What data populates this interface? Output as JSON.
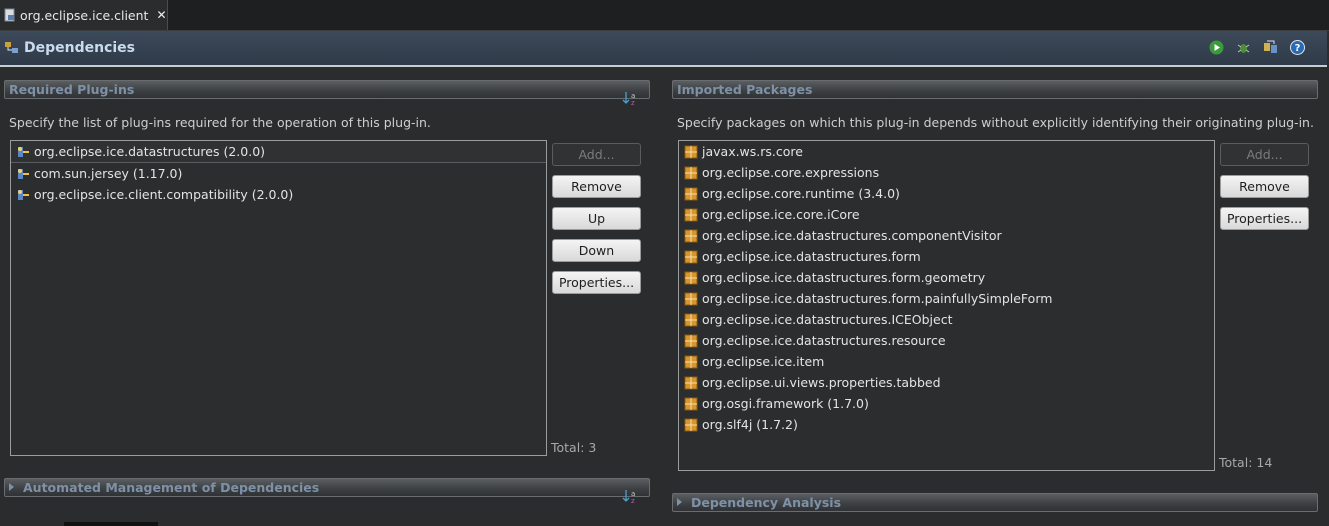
{
  "editor_tab": {
    "label": "org.eclipse.ice.client",
    "close": "✕",
    "icon": "plugin-manifest-icon"
  },
  "form": {
    "title": "Dependencies",
    "title_icon": "dependencies-icon",
    "toolbar_icons": [
      "run-icon",
      "debug-icon",
      "export-icon",
      "help-icon"
    ]
  },
  "required_plugins": {
    "title": "Required Plug-ins",
    "description": "Specify the list of plug-ins required for the operation of this plug-in.",
    "items": [
      {
        "label": "org.eclipse.ice.datastructures (2.0.0)",
        "icon": "plugin-icon"
      },
      {
        "label": "com.sun.jersey (1.17.0)",
        "icon": "plugin-icon"
      },
      {
        "label": "org.eclipse.ice.client.compatibility (2.0.0)",
        "icon": "plugin-icon"
      }
    ],
    "buttons": {
      "add": "Add...",
      "remove": "Remove",
      "up": "Up",
      "down": "Down",
      "properties": "Properties..."
    },
    "total": "Total: 3"
  },
  "imported_packages": {
    "title": "Imported Packages",
    "description": "Specify packages on which this plug-in depends without explicitly identifying their originating plug-in.",
    "items": [
      {
        "label": "javax.ws.rs.core",
        "icon": "package-icon"
      },
      {
        "label": "org.eclipse.core.expressions",
        "icon": "package-icon"
      },
      {
        "label": "org.eclipse.core.runtime (3.4.0)",
        "icon": "package-icon"
      },
      {
        "label": "org.eclipse.ice.core.iCore",
        "icon": "package-icon"
      },
      {
        "label": "org.eclipse.ice.datastructures.componentVisitor",
        "icon": "package-icon"
      },
      {
        "label": "org.eclipse.ice.datastructures.form",
        "icon": "package-icon"
      },
      {
        "label": "org.eclipse.ice.datastructures.form.geometry",
        "icon": "package-icon"
      },
      {
        "label": "org.eclipse.ice.datastructures.form.painfullySimpleForm",
        "icon": "package-icon"
      },
      {
        "label": "org.eclipse.ice.datastructures.ICEObject",
        "icon": "package-icon"
      },
      {
        "label": "org.eclipse.ice.datastructures.resource",
        "icon": "package-icon"
      },
      {
        "label": "org.eclipse.ice.item",
        "icon": "package-icon"
      },
      {
        "label": "org.eclipse.ui.views.properties.tabbed",
        "icon": "package-icon"
      },
      {
        "label": "org.osgi.framework (1.7.0)",
        "icon": "package-icon"
      },
      {
        "label": "org.slf4j (1.7.2)",
        "icon": "package-icon"
      }
    ],
    "buttons": {
      "add": "Add...",
      "remove": "Remove",
      "properties": "Properties..."
    },
    "total": "Total: 14"
  },
  "automated_management": {
    "title": "Automated Management of Dependencies"
  },
  "dependency_analysis": {
    "title": "Dependency Analysis"
  }
}
